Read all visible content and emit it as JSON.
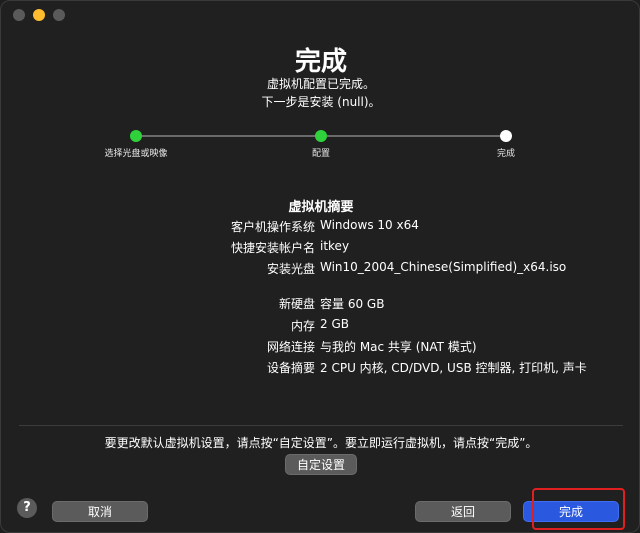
{
  "header": {
    "title": "完成",
    "subtitle_line1": "虚拟机配置已完成。",
    "subtitle_line2": "下一步是安装 (null)。"
  },
  "steps": [
    {
      "label": "选择光盘或映像",
      "status": "done"
    },
    {
      "label": "配置",
      "status": "done"
    },
    {
      "label": "完成",
      "status": "current"
    }
  ],
  "summary": {
    "title": "虚拟机摘要",
    "rows1": [
      {
        "key": "客户机操作系统",
        "value": "Windows 10 x64"
      },
      {
        "key": "快捷安装帐户名",
        "value": "itkey"
      },
      {
        "key": "安装光盘",
        "value": "Win10_2004_Chinese(Simplified)_x64.iso"
      }
    ],
    "rows2": [
      {
        "key": "新硬盘",
        "value": "容量 60 GB"
      },
      {
        "key": "内存",
        "value": "2 GB"
      },
      {
        "key": "网络连接",
        "value": "与我的 Mac 共享 (NAT 模式)"
      },
      {
        "key": "设备摘要",
        "value": "2 CPU 内核, CD/DVD, USB 控制器, 打印机, 声卡"
      }
    ]
  },
  "footer": {
    "hint": "要更改默认虚拟机设置，请点按“自定设置”。要立即运行虚拟机，请点按“完成”。",
    "custom_label": "自定设置",
    "help_label": "?",
    "cancel_label": "取消",
    "back_label": "返回",
    "finish_label": "完成"
  },
  "colors": {
    "step_done": "#2fd23a",
    "step_pending": "#ffffff",
    "primary_button": "#2a59e0",
    "highlight": "#e02020"
  }
}
